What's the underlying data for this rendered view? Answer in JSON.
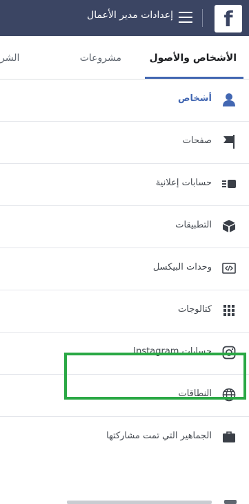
{
  "header": {
    "logo_letter": "f",
    "title": "إعدادات مدير الأعمال",
    "bg_color": "#3b4563"
  },
  "tabs": [
    {
      "label": "الأشخاص والأصول",
      "active": true
    },
    {
      "label": "مشروعات",
      "active": false
    },
    {
      "label": "الشر",
      "active": false
    }
  ],
  "sidebar": {
    "items": [
      {
        "label": "أشخاص",
        "icon": "person-icon",
        "active": true
      },
      {
        "label": "صفحات",
        "icon": "flag-icon",
        "active": false
      },
      {
        "label": "حسابات إعلانية",
        "icon": "ad-account-icon",
        "active": false
      },
      {
        "label": "التطبيقات",
        "icon": "cube-icon",
        "active": false
      },
      {
        "label": "وحدات البيكسل",
        "icon": "code-icon",
        "active": false
      },
      {
        "label": "كتالوجات",
        "icon": "grid-icon",
        "active": false
      },
      {
        "label": "حسابات Instagram",
        "icon": "instagram-icon",
        "active": false,
        "highlighted": true
      },
      {
        "label": "النطاقات",
        "icon": "globe-icon",
        "active": false
      },
      {
        "label": "الجماهير التي تمت مشاركتها",
        "icon": "briefcase-icon",
        "active": false
      }
    ]
  },
  "colors": {
    "accent": "#4267b2",
    "highlight": "#2aa845"
  }
}
